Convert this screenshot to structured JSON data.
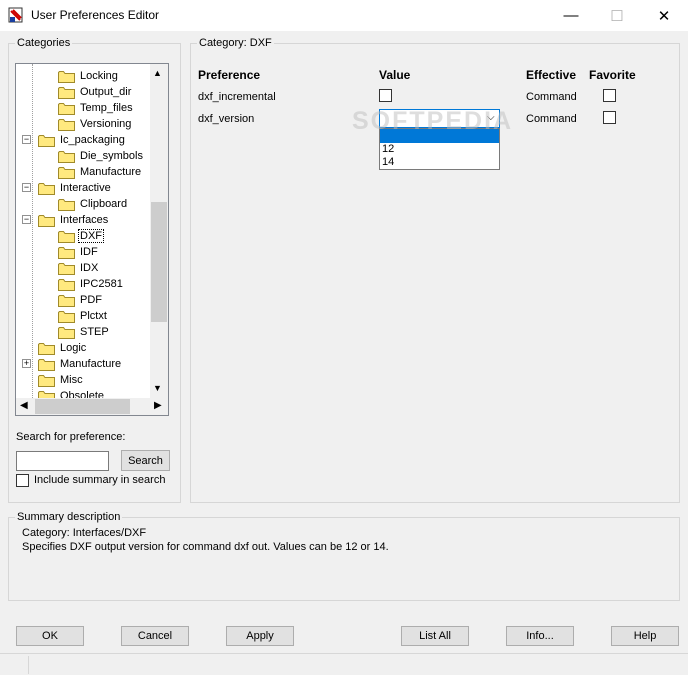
{
  "window": {
    "title": "User Preferences Editor",
    "minimize": "—",
    "maximize": "☐",
    "close": "✕"
  },
  "categories": {
    "label": "Categories",
    "tree": [
      {
        "label": "Locking",
        "level": 2,
        "selected": false
      },
      {
        "label": "Output_dir",
        "level": 2,
        "selected": false
      },
      {
        "label": "Temp_files",
        "level": 2,
        "selected": false
      },
      {
        "label": "Versioning",
        "level": 2,
        "selected": false
      },
      {
        "label": "Ic_packaging",
        "level": 1,
        "expander": "-"
      },
      {
        "label": "Die_symbols",
        "level": 2,
        "selected": false
      },
      {
        "label": "Manufacture",
        "level": 2,
        "selected": false
      },
      {
        "label": "Interactive",
        "level": 1,
        "expander": "-"
      },
      {
        "label": "Clipboard",
        "level": 2,
        "selected": false
      },
      {
        "label": "Interfaces",
        "level": 1,
        "expander": "-"
      },
      {
        "label": "DXF",
        "level": 2,
        "selected": true
      },
      {
        "label": "IDF",
        "level": 2,
        "selected": false
      },
      {
        "label": "IDX",
        "level": 2,
        "selected": false
      },
      {
        "label": "IPC2581",
        "level": 2,
        "selected": false
      },
      {
        "label": "PDF",
        "level": 2,
        "selected": false
      },
      {
        "label": "Plctxt",
        "level": 2,
        "selected": false
      },
      {
        "label": "STEP",
        "level": 2,
        "selected": false
      },
      {
        "label": "Logic",
        "level": 1,
        "expander": ""
      },
      {
        "label": "Manufacture",
        "level": 1,
        "expander": "+"
      },
      {
        "label": "Misc",
        "level": 1,
        "expander": ""
      },
      {
        "label": "Obsolete",
        "level": 1,
        "expander": ""
      }
    ]
  },
  "search": {
    "label": "Search for preference:",
    "value": "",
    "button": "Search",
    "include_summary": "Include summary in search",
    "include_summary_checked": false
  },
  "category_panel": {
    "label": "Category:  DXF",
    "headers": {
      "preference": "Preference",
      "value": "Value",
      "effective": "Effective",
      "favorite": "Favorite"
    },
    "rows": [
      {
        "preference": "dxf_incremental",
        "effective": "Command"
      },
      {
        "preference": "dxf_version",
        "effective": "Command"
      }
    ],
    "dropdown_options": [
      "",
      "12",
      "14"
    ]
  },
  "summary": {
    "label": "Summary description",
    "line1": "Category: Interfaces/DXF",
    "line2": "Specifies DXF output version for command dxf out. Values can be 12 or 14."
  },
  "buttons": {
    "ok": "OK",
    "cancel": "Cancel",
    "apply": "Apply",
    "list_all": "List All",
    "info": "Info...",
    "help": "Help"
  },
  "watermark": "SOFTPEDIA",
  "colors": {
    "selection": "#0078d7",
    "folder": "#ffe97f",
    "folder_border": "#a08a2a"
  }
}
